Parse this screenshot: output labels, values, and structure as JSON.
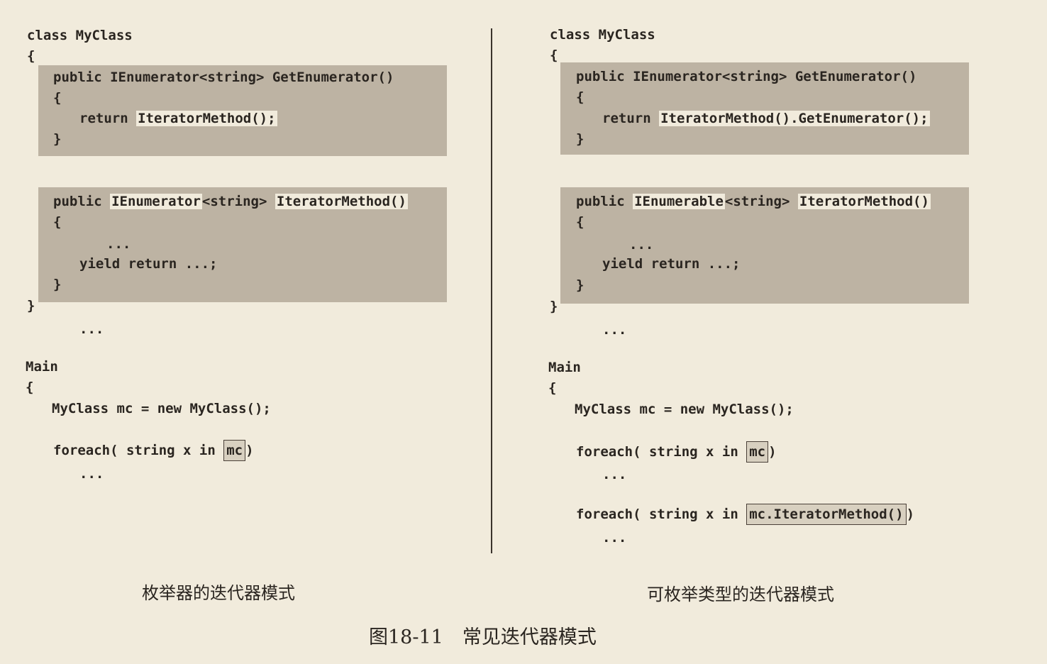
{
  "left": {
    "class_decl": "class MyClass",
    "open_brace": "{",
    "block1": {
      "line1_pre": "public IEnumerator<string> GetEnumerator()",
      "line2": "{",
      "return_kw": "return ",
      "return_expr": "IteratorMethod();",
      "line4": "}"
    },
    "block2": {
      "public_kw": "public ",
      "type_hl": "IEnumerator",
      "type_rest": "<string> ",
      "method_hl": "IteratorMethod()",
      "line2": "{",
      "dots": "...",
      "yield": "yield return ...;",
      "line5": "}"
    },
    "close_brace": "}",
    "after_dots": "...",
    "main": "Main",
    "main_open": "{",
    "new_line": "MyClass mc = new MyClass();",
    "foreach_pre": "foreach( string x in ",
    "foreach_box": "mc",
    "foreach_post": ")",
    "foreach_dots": "...",
    "caption": "枚举器的迭代器模式"
  },
  "right": {
    "class_decl": "class MyClass",
    "open_brace": "{",
    "block1": {
      "line1_pre": "public IEnumerator<string> GetEnumerator()",
      "line2": "{",
      "return_kw": "return ",
      "return_expr": "IteratorMethod().GetEnumerator();",
      "line4": "}"
    },
    "block2": {
      "public_kw": "public ",
      "type_hl": "IEnumerable",
      "type_rest": "<string> ",
      "method_hl": "IteratorMethod()",
      "line2": "{",
      "dots": "...",
      "yield": "yield return ...;",
      "line5": "}"
    },
    "close_brace": "}",
    "after_dots": "...",
    "main": "Main",
    "main_open": "{",
    "new_line": "MyClass mc = new MyClass();",
    "foreach1_pre": "foreach( string x in ",
    "foreach1_box": "mc",
    "foreach1_post": ")",
    "foreach1_dots": "...",
    "foreach2_pre": "foreach( string x in ",
    "foreach2_box": "mc.IteratorMethod()",
    "foreach2_post": ")",
    "foreach2_dots": "...",
    "caption": "可枚举类型的迭代器模式"
  },
  "figure_caption": "图18-11　常见迭代器模式"
}
